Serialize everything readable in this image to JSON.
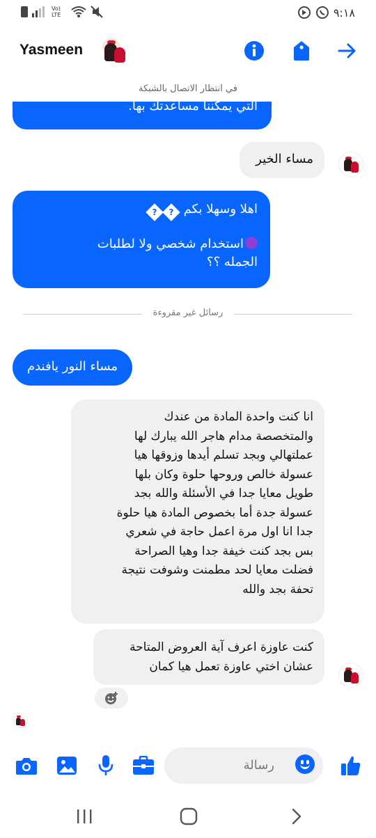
{
  "status_bar": {
    "time": "٩:١٨",
    "network_label": "Vo) LTE"
  },
  "header": {
    "contact_name": "Yasmeen",
    "network_status": "في انتظار الاتصال بالشبكة"
  },
  "messages": {
    "top_partial": "التي يمكننا مساعدتك بها.",
    "good_evening": "مساء الخير",
    "welcome_line1": "اهلا وسهلا بكم",
    "welcome_line2": "استخدام شخصي ولا لطلبات",
    "welcome_line3": "الجمله ؟؟",
    "unread_divider": "رسائل غير مقروءة",
    "reply": "مساء النور يافندم",
    "long_lines": [
      "انا كنت واحدة المادة من عندك",
      "والمتخصصة مدام هاجر الله يبارك لها",
      "عملتهالي وبجد تسلم أيدها وزوقها هيا",
      "عسولة خالص وروحها حلوة وكان بلها",
      "طويل معايا جدا في الأسئلة والله بجد",
      "عسولة جدة أما بخصوص المادة هيا حلوة",
      "جدا انا اول مرة اعمل حاجة في شعري",
      "بس بجد كنت خيفة جدا وهيا الصراحة",
      "فضلت معايا لحد مطمنت وشوفت نتيجة",
      "تحفة بجد والله"
    ],
    "ask_lines": [
      "كنت عاوزة اعرف آية العروض المتاحة",
      "عشان اختي عاوزة تعمل هيا كمان"
    ]
  },
  "composer": {
    "placeholder": "رسالة"
  },
  "colors": {
    "accent": "#0866ff",
    "incoming_bubble": "#f0f0f2",
    "purple_emoji": "#8b3fd6"
  },
  "icons": {
    "header": [
      "info-icon",
      "tag-icon",
      "forward-arrow-icon"
    ],
    "composer": [
      "camera-icon",
      "image-icon",
      "microphone-icon",
      "briefcase-icon",
      "emoji-icon",
      "thumbs-up-icon"
    ],
    "nav": [
      "recent-apps-icon",
      "home-icon",
      "back-icon"
    ]
  }
}
